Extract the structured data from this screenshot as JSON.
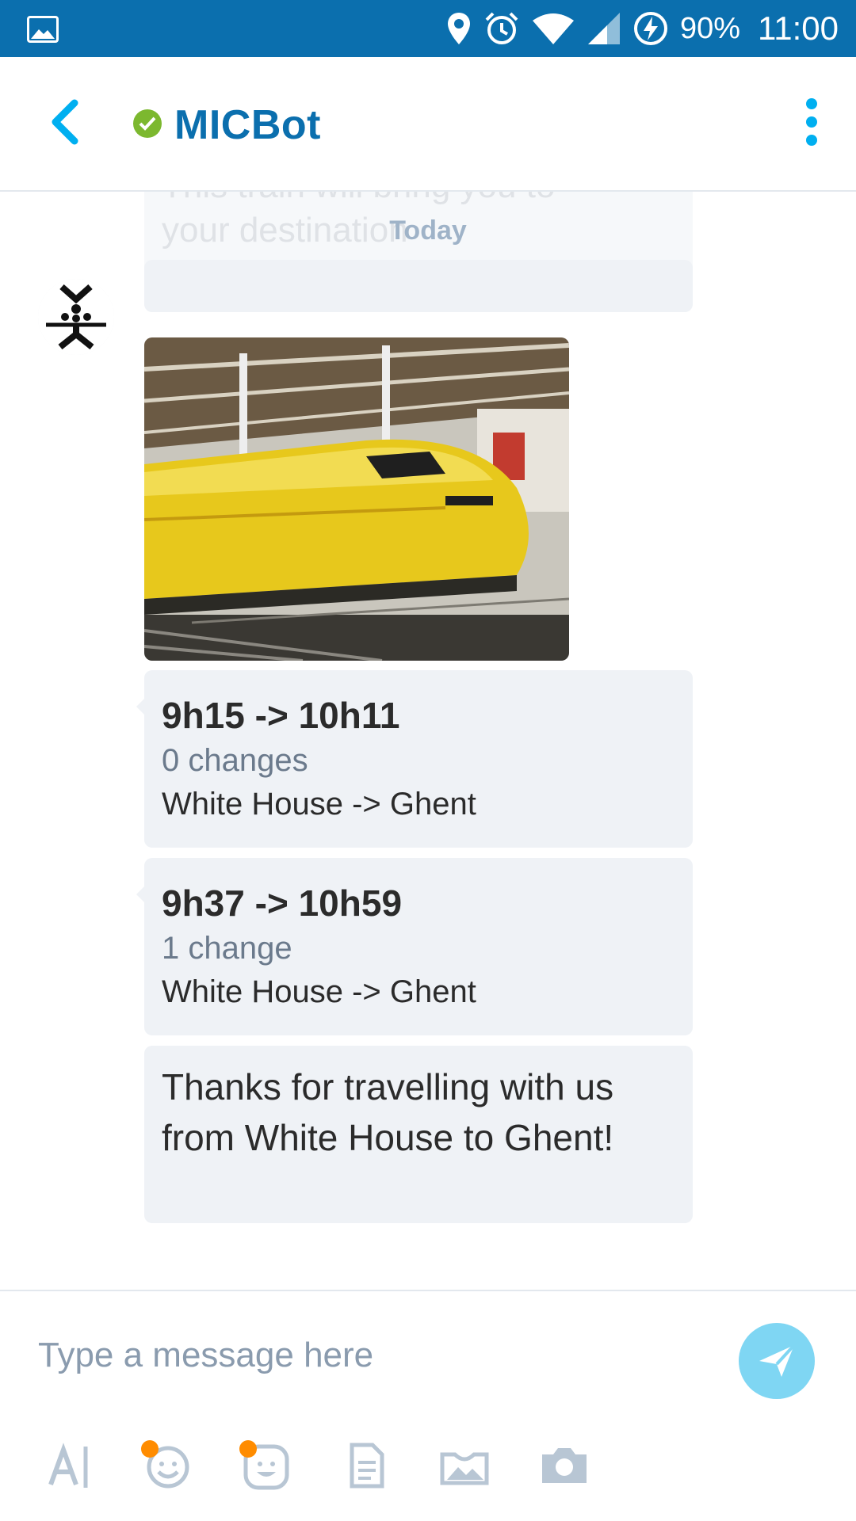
{
  "status_bar": {
    "battery": "90%",
    "time": "11:00"
  },
  "header": {
    "title": "MICBot"
  },
  "chat": {
    "faded_lines": [
      "This train will bring you to",
      "your destination"
    ],
    "date_label": "Today",
    "trips": [
      {
        "times": "9h15 -> 10h11",
        "changes": "0 changes",
        "route": "White House -> Ghent"
      },
      {
        "times": "9h37 -> 10h59",
        "changes": "1 change",
        "route": "White House -> Ghent"
      }
    ],
    "thanks_lines": [
      "Thanks for travelling with us",
      "from White House to Ghent!"
    ]
  },
  "composer": {
    "placeholder": "Type a message here"
  },
  "colors": {
    "status_bar": "#0b6fae",
    "accent": "#00aff0",
    "presence": "#7cb82f",
    "bubble": "#eff2f6",
    "send_button": "#7fd6f3",
    "badge": "#ff8c00"
  },
  "icons": {
    "status_bar": [
      "gallery-icon",
      "location-icon",
      "alarm-icon",
      "wifi-icon",
      "signal-icon",
      "battery-charging-icon"
    ],
    "toolbar": [
      "text-format-icon",
      "emoji-icon",
      "sticker-icon",
      "file-icon",
      "media-bar-icon",
      "camera-icon"
    ]
  }
}
